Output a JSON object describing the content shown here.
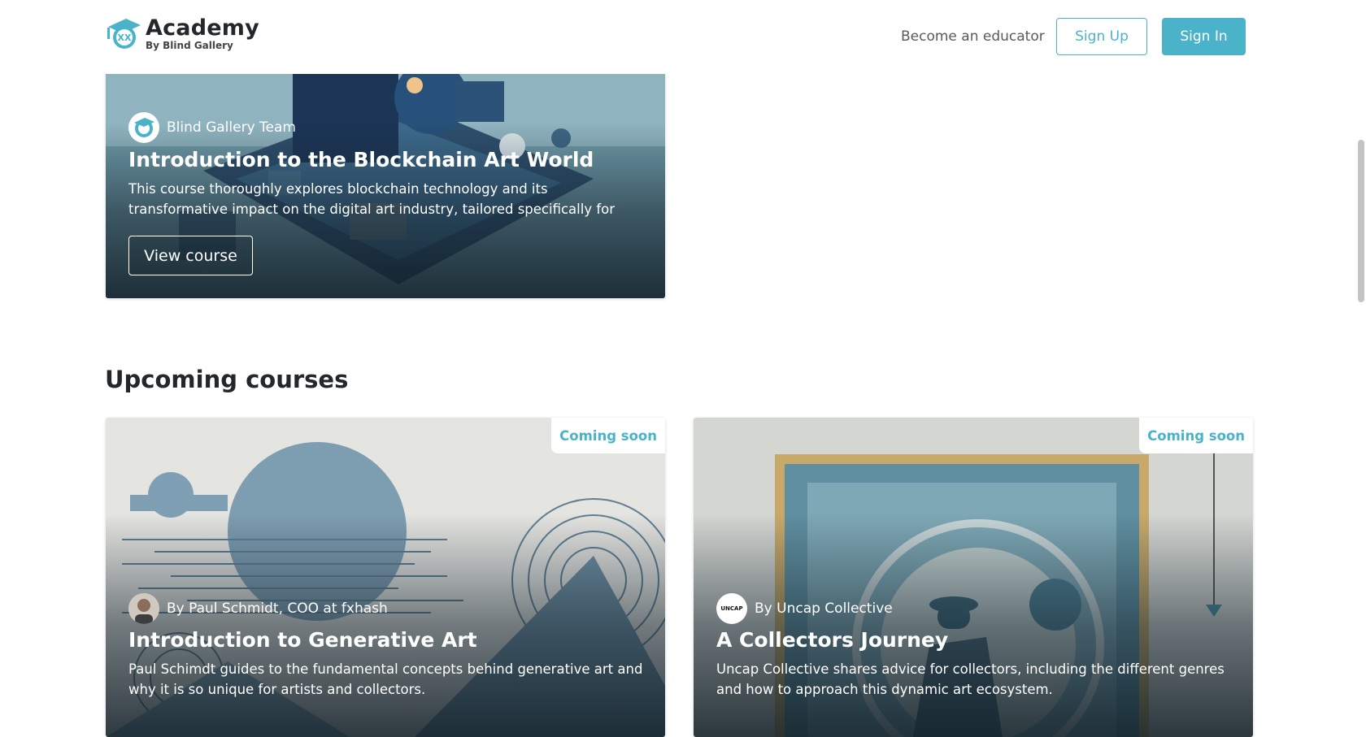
{
  "header": {
    "logo_title": "Academy",
    "logo_subtitle": "By Blind Gallery",
    "become_educator": "Become an educator",
    "sign_up": "Sign Up",
    "sign_in": "Sign In"
  },
  "featured_course": {
    "author": "Blind Gallery Team",
    "title": "Introduction to the Blockchain Art World",
    "description": "This course thoroughly explores blockchain technology and its transformative impact on the digital art industry, tailored specifically for art…",
    "button": "View course"
  },
  "upcoming": {
    "section_title": "Upcoming courses",
    "courses": [
      {
        "badge": "Coming soon",
        "author": "By Paul Schmidt, COO at fxhash",
        "title": "Introduction to Generative Art",
        "description": "Paul Schimdt guides to the fundamental concepts behind generative art and why it is so unique for artists and collectors."
      },
      {
        "badge": "Coming soon",
        "author": "By Uncap Collective",
        "avatar_text": "UNCAP",
        "title": "A Collectors Journey",
        "description": "Uncap Collective shares advice for collectors, including the different genres and how to approach this dynamic art ecosystem."
      }
    ]
  },
  "colors": {
    "accent": "#4bb3c9",
    "text_dark": "#23262b"
  }
}
